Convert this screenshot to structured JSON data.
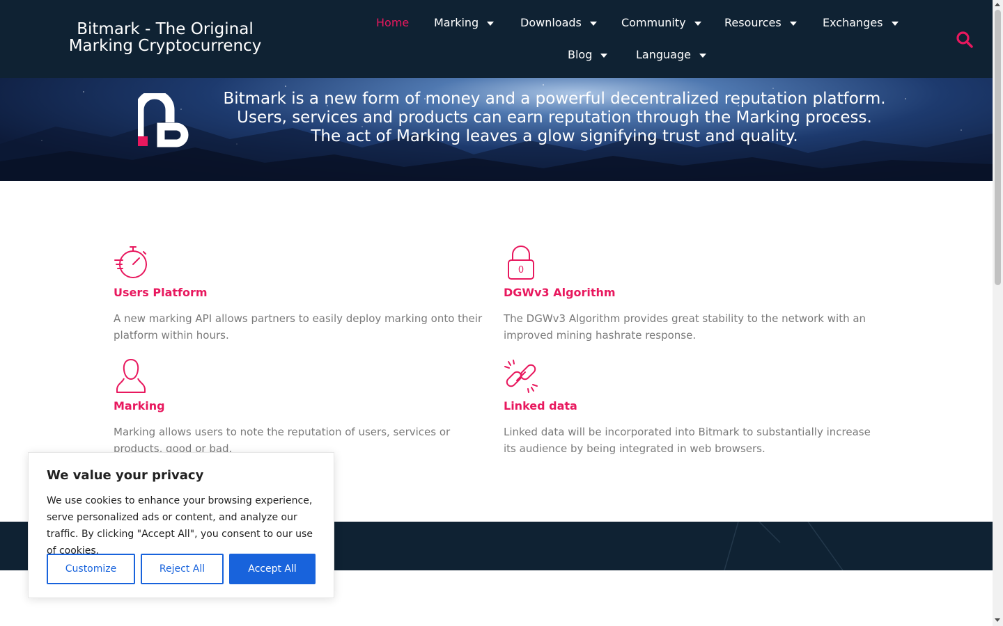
{
  "colors": {
    "brand_pink": "#e8185e",
    "header_bg": "#0f2233",
    "accent_blue": "#1863dc"
  },
  "header": {
    "site_title": "Bitmark - The Original Marking Cryptocurrency",
    "nav": [
      {
        "label": "Home",
        "dropdown": false,
        "active": true
      },
      {
        "label": "Marking",
        "dropdown": true
      },
      {
        "label": "Downloads",
        "dropdown": true
      },
      {
        "label": "Community",
        "dropdown": true
      },
      {
        "label": "Resources",
        "dropdown": true
      },
      {
        "label": "Exchanges",
        "dropdown": true
      },
      {
        "label": "Blog",
        "dropdown": true
      },
      {
        "label": "Language",
        "dropdown": true
      }
    ],
    "search_icon": "search-icon"
  },
  "hero": {
    "text": "Bitmark is a new form of money and a powerful decentralized reputation platform. Users, services and products can earn reputation through the Marking process. The act of Marking leaves a glow signifying trust and quality.",
    "logo_icon": "bitmark-logo"
  },
  "features": [
    {
      "icon": "stopwatch-icon",
      "title": "Users Platform",
      "desc": "A new marking API allows partners to easily deploy marking onto their platform within hours."
    },
    {
      "icon": "lock-icon",
      "title": "DGWv3 Algorithm",
      "desc": "The DGWv3 Algorithm provides great stability to the network with an improved mining hashrate response.",
      "icon_text": "0"
    },
    {
      "icon": "user-icon",
      "title": "Marking",
      "desc": "Marking allows users to note the reputation of users, services or products, good or bad."
    },
    {
      "icon": "link-icon",
      "title": "Linked data",
      "desc": "Linked data will be incorporated into Bitmark to substantially increase its audience by being integrated in web browsers."
    }
  ],
  "cookie": {
    "title": "We value your privacy",
    "text": "We use cookies to enhance your browsing experience, serve personalized ads or content, and analyze our traffic. By clicking \"Accept All\", you consent to our use of cookies.",
    "buttons": {
      "customize": "Customize",
      "reject": "Reject All",
      "accept": "Accept All"
    }
  }
}
